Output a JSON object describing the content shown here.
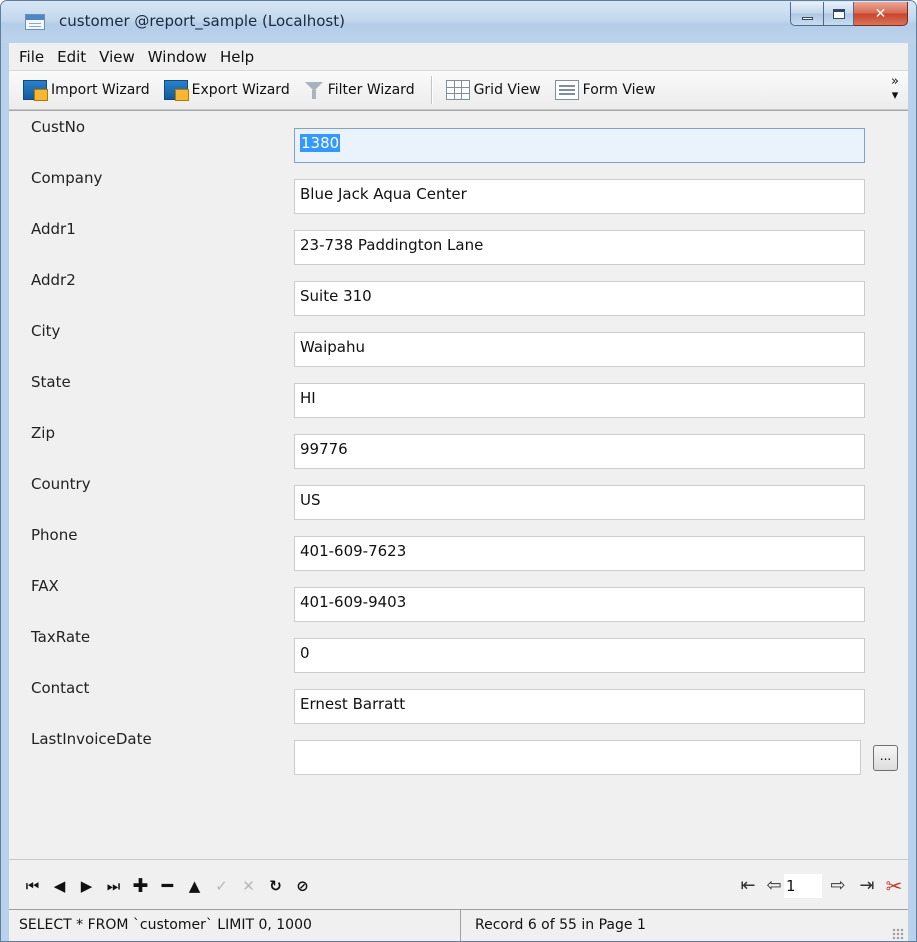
{
  "window": {
    "title": "customer @report_sample (Localhost)"
  },
  "menu": [
    "File",
    "Edit",
    "View",
    "Window",
    "Help"
  ],
  "toolbar": {
    "import_label": "Import Wizard",
    "export_label": "Export Wizard",
    "filter_label": "Filter Wizard",
    "grid_label": "Grid View",
    "form_label": "Form View"
  },
  "form": {
    "fields": [
      {
        "label": "CustNo",
        "value": "1380"
      },
      {
        "label": "Company",
        "value": "Blue Jack Aqua Center"
      },
      {
        "label": "Addr1",
        "value": "23-738 Paddington Lane"
      },
      {
        "label": "Addr2",
        "value": "Suite 310"
      },
      {
        "label": "City",
        "value": "Waipahu"
      },
      {
        "label": "State",
        "value": "HI"
      },
      {
        "label": "Zip",
        "value": "99776"
      },
      {
        "label": "Country",
        "value": "US"
      },
      {
        "label": "Phone",
        "value": "401-609-7623"
      },
      {
        "label": "FAX",
        "value": "401-609-9403"
      },
      {
        "label": "TaxRate",
        "value": "0"
      },
      {
        "label": "Contact",
        "value": "Ernest Barratt"
      },
      {
        "label": "LastInvoiceDate",
        "value": ""
      }
    ],
    "date_button_label": "..."
  },
  "navigation": {
    "icons": [
      "first-record-icon",
      "prior-record-icon",
      "next-record-icon",
      "last-record-icon",
      "insert-record-icon",
      "delete-record-icon",
      "edit-record-icon",
      "post-edit-icon",
      "cancel-edit-icon",
      "refresh-icon",
      "stop-icon"
    ],
    "page_number": "1"
  },
  "status": {
    "sql": "SELECT * FROM `customer` LIMIT 0, 1000",
    "record": "Record 6 of 55 in Page 1"
  }
}
